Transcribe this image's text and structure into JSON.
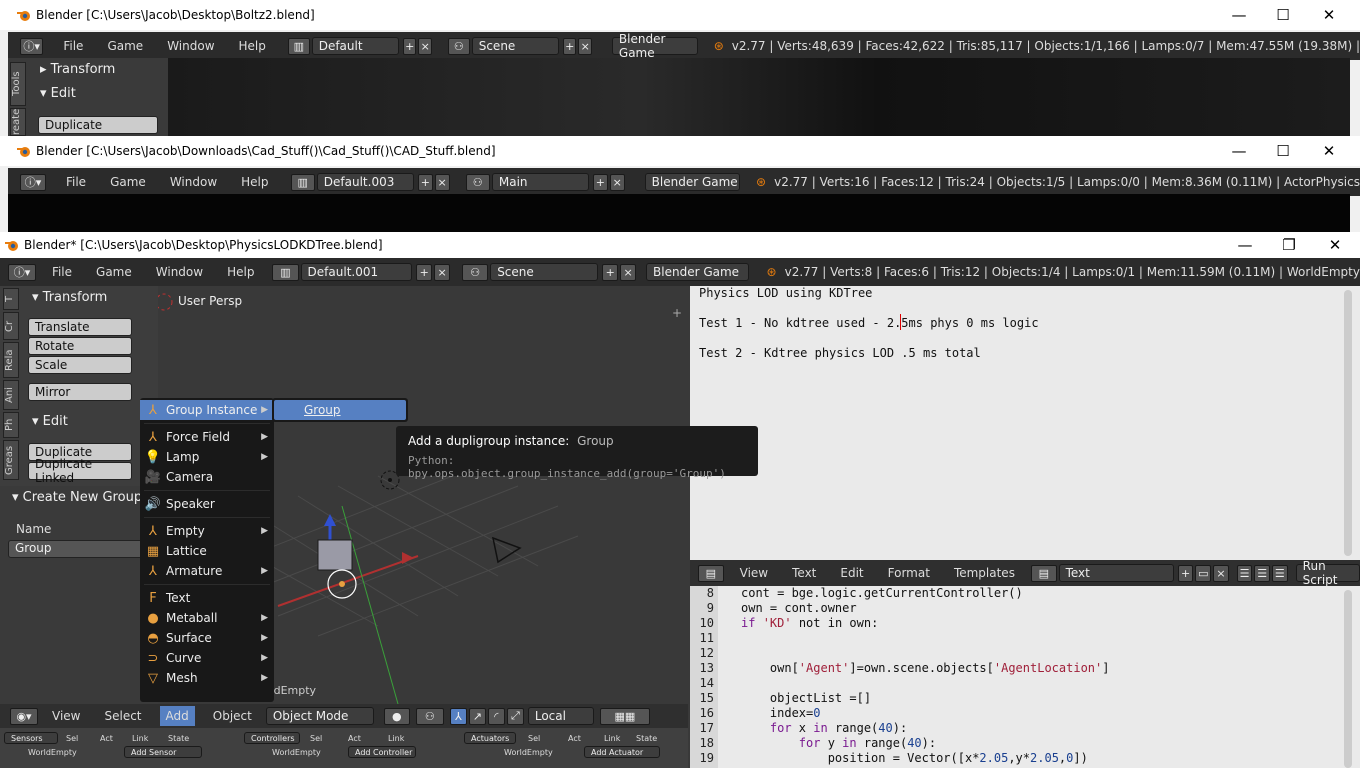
{
  "windows": [
    {
      "title": "Blender [C:\\Users\\Jacob\\Desktop\\Boltz2.blend]",
      "menus": [
        "File",
        "Game",
        "Window",
        "Help"
      ],
      "screen": "Default",
      "scene": "Scene",
      "engine": "Blender Game",
      "status": "v2.77 | Verts:48,639 | Faces:42,622 | Tris:85,117 | Objects:1/1,166 | Lamps:0/7 | Mem:47.55M (19.38M) |",
      "tabs": [
        "Tools",
        "reate"
      ],
      "panels": {
        "transform": "Transform",
        "edit": "Edit",
        "duplicate": "Duplicate"
      }
    },
    {
      "title": "Blender [C:\\Users\\Jacob\\Downloads\\Cad_Stuff()\\Cad_Stuff()\\CAD_Stuff.blend]",
      "menus": [
        "File",
        "Game",
        "Window",
        "Help"
      ],
      "screen": "Default.003",
      "scene": "Main",
      "engine": "Blender Game",
      "status": "v2.77 | Verts:16 | Faces:12 | Tris:24 | Objects:1/5 | Lamps:0/0 | Mem:8.36M (0.11M) | ActorPhysics"
    },
    {
      "title": "Blender* [C:\\Users\\Jacob\\Desktop\\PhysicsLODKDTree.blend]",
      "menus": [
        "File",
        "Game",
        "Window",
        "Help"
      ],
      "screen": "Default.001",
      "scene": "Scene",
      "engine": "Blender Game",
      "status": "v2.77 | Verts:8 | Faces:6 | Tris:12 | Objects:1/4 | Lamps:0/1 | Mem:11.59M (0.11M) | WorldEmpty"
    }
  ],
  "winctl": {
    "minimize": "—",
    "maximize": "☐",
    "restore": "❐",
    "close": "✕"
  },
  "toolshelf": {
    "tabs": [
      "T",
      "Cr",
      "Rela",
      "Ani",
      "Ph",
      "Greas"
    ],
    "transform_header": "Transform",
    "transform_buttons": [
      "Translate",
      "Rotate",
      "Scale"
    ],
    "mirror": "Mirror",
    "edit_header": "Edit",
    "edit_buttons": [
      "Duplicate",
      "Duplicate Linked"
    ],
    "create_group_header": "Create New Group",
    "name_label": "Name",
    "name_value": "Group"
  },
  "viewport": {
    "label": "User Persp",
    "object_label": "(1) WorldEmpty",
    "header": {
      "view": "View",
      "select": "Select",
      "add": "Add",
      "object": "Object",
      "mode": "Object Mode",
      "orientation": "Local"
    }
  },
  "add_menu": {
    "items": [
      {
        "label": "Group Instance",
        "icon": "empty-axes-icon",
        "glyph": "⅄",
        "submenu": true
      },
      {
        "label": "Force Field",
        "icon": "force-field-icon",
        "glyph": "⅄",
        "submenu": true
      },
      {
        "label": "Lamp",
        "icon": "lamp-icon",
        "glyph": "💡",
        "submenu": true
      },
      {
        "label": "Camera",
        "icon": "camera-icon",
        "glyph": "🎥",
        "submenu": false
      },
      {
        "label": "Speaker",
        "icon": "speaker-icon",
        "glyph": "🔊",
        "submenu": false
      },
      {
        "label": "Empty",
        "icon": "empty-icon",
        "glyph": "⅄",
        "submenu": true
      },
      {
        "label": "Lattice",
        "icon": "lattice-icon",
        "glyph": "▦",
        "submenu": false
      },
      {
        "label": "Armature",
        "icon": "armature-icon",
        "glyph": "⅄",
        "submenu": true
      },
      {
        "label": "Text",
        "icon": "text-icon",
        "glyph": "F",
        "submenu": false
      },
      {
        "label": "Metaball",
        "icon": "metaball-icon",
        "glyph": "●",
        "submenu": true
      },
      {
        "label": "Surface",
        "icon": "surface-icon",
        "glyph": "◓",
        "submenu": true
      },
      {
        "label": "Curve",
        "icon": "curve-icon",
        "glyph": "⊃",
        "submenu": true
      },
      {
        "label": "Mesh",
        "icon": "mesh-icon",
        "glyph": "▽",
        "submenu": true
      }
    ],
    "submenu_item": "Group"
  },
  "tooltip": {
    "title": "Add a dupligroup instance:",
    "value": "Group",
    "python": "Python: bpy.ops.object.group_instance_add(group='Group')"
  },
  "text_top": {
    "lines": [
      "Physics LOD using KDTree",
      "",
      "Test 1 - No kdtree used - 2.5ms phys 0 ms logic",
      "",
      "Test 2 - Kdtree physics LOD .5 ms total"
    ]
  },
  "text_editor": {
    "menus": [
      "View",
      "Text",
      "Edit",
      "Format",
      "Templates"
    ],
    "datablock": "Text",
    "run_script": "Run Script",
    "line_numbers": [
      "8",
      "9",
      "10",
      "11",
      "12",
      "13",
      "14",
      "15",
      "16",
      "17",
      "18",
      "19"
    ]
  },
  "logic": {
    "sensors": "Sensors",
    "controllers": "Controllers",
    "actuators": "Actuators",
    "sel": "Sel",
    "act": "Act",
    "link": "Link",
    "state": "State",
    "object": "WorldEmpty",
    "add_sensor": "Add Sensor",
    "add_controller": "Add Controller",
    "add_actuator": "Add Actuator"
  }
}
